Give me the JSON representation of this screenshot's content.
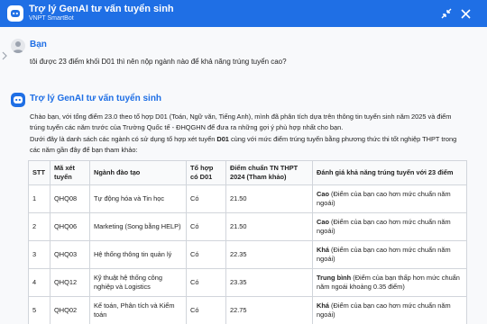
{
  "header": {
    "title": "Trợ lý GenAI tư vấn tuyển sinh",
    "subtitle": "VNPT SmartBot",
    "expand_icon": "collapse-arrows-icon",
    "close_icon": "close-icon",
    "color": "#1f6fe5"
  },
  "user": {
    "name": "Bạn",
    "message": "tôi được 23 điểm khối D01 thì nên nộp ngành nào để khả năng trúng tuyển cao?"
  },
  "bot": {
    "name": "Trợ lý GenAI tư vấn tuyển sinh",
    "paragraph1": "Chào bạn, với tổng điểm 23.0 theo tổ hợp D01 (Toán, Ngữ văn, Tiếng Anh), mình đã phân tích dựa trên thông tin tuyển sinh năm 2025 và điểm trúng tuyển các năm trước của Trường Quốc tế - ĐHQGHN để đưa ra những gợi ý phù hợp nhất cho bạn.",
    "paragraph2_pre": "Dưới đây là danh sách các ngành có sử dụng tổ hợp xét tuyển ",
    "paragraph2_bold": "D01",
    "paragraph2_post": " cùng với mức điểm trúng tuyển bằng phương thức thi tốt nghiệp THPT trong các năm gần đây để bạn tham khảo:"
  },
  "table": {
    "headers": [
      "STT",
      "Mã xét tuyển",
      "Ngành đào tạo",
      "Tổ hợp có D01",
      "Điểm chuẩn TN THPT 2024 (Tham khảo)",
      "Đánh giá khả năng trúng tuyển với 23 điểm"
    ],
    "rows": [
      {
        "stt": "1",
        "code": "QHQ08",
        "major": "Tự động hóa và Tin học",
        "d01": "Có",
        "score": "21.50",
        "rating": "Cao",
        "note": " (Điểm của bạn cao hơn mức chuẩn năm ngoái)"
      },
      {
        "stt": "2",
        "code": "QHQ06",
        "major": "Marketing (Song bằng HELP)",
        "d01": "Có",
        "score": "21.50",
        "rating": "Cao",
        "note": " (Điểm của bạn cao hơn mức chuẩn năm ngoái)"
      },
      {
        "stt": "3",
        "code": "QHQ03",
        "major": "Hệ thống thông tin quản lý",
        "d01": "Có",
        "score": "22.35",
        "rating": "Khá",
        "note": " (Điểm của bạn cao hơn mức chuẩn năm ngoái)"
      },
      {
        "stt": "4",
        "code": "QHQ12",
        "major": "Kỹ thuật hệ thống công nghiệp và Logistics",
        "d01": "Có",
        "score": "23.35",
        "rating": "Trung bình",
        "note": " (Điểm của bạn thấp hơn mức chuẩn năm ngoái khoảng 0.35 điểm)"
      },
      {
        "stt": "5",
        "code": "QHQ02",
        "major": "Kế toán, Phân tích và Kiểm toán",
        "d01": "Có",
        "score": "22.75",
        "rating": "Khá",
        "note": " (Điểm của bạn cao hơn mức chuẩn năm ngoái)"
      }
    ]
  }
}
